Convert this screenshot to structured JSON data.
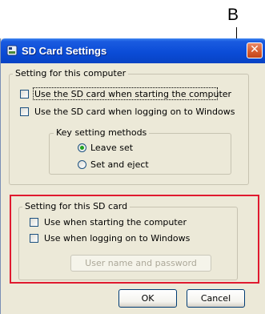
{
  "annotation": {
    "callout_label": "B",
    "highlight_color": "#e0202f"
  },
  "window": {
    "title": "SD Card Settings",
    "close_label": "✕"
  },
  "computer_group": {
    "legend": "Setting for this computer",
    "options": [
      {
        "label": "Use the SD card when starting the computer",
        "checked": false
      },
      {
        "label": "Use the SD card when logging on to Windows",
        "checked": false
      }
    ],
    "key_methods": {
      "legend": "Key setting methods",
      "options": [
        {
          "label": "Leave set",
          "selected": true
        },
        {
          "label": "Set and eject",
          "selected": false
        }
      ]
    }
  },
  "sd_group": {
    "legend": "Setting for this SD card",
    "options": [
      {
        "label": "Use when starting the computer",
        "checked": false
      },
      {
        "label": "Use when logging on to Windows",
        "checked": false
      }
    ],
    "password_button": "User name and password"
  },
  "buttons": {
    "ok": "OK",
    "cancel": "Cancel"
  }
}
